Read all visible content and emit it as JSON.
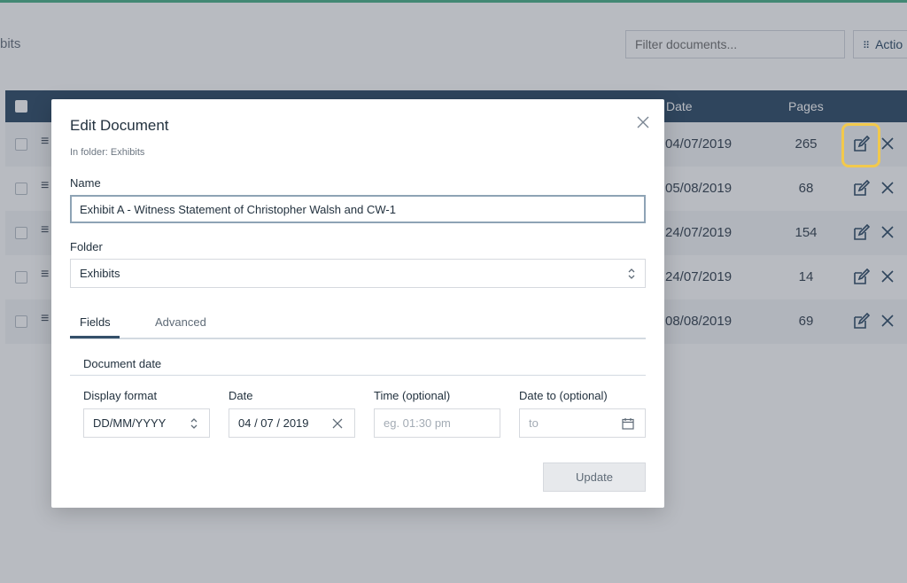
{
  "background": {
    "breadcrumb": "bits",
    "filter_placeholder": "Filter documents...",
    "actions_label": "Actio",
    "table": {
      "headers": {
        "date": "Date",
        "pages": "Pages"
      },
      "rows": [
        {
          "date": "04/07/2019",
          "pages": "265"
        },
        {
          "date": "05/08/2019",
          "pages": "68"
        },
        {
          "date": "24/07/2019",
          "pages": "154"
        },
        {
          "date": "24/07/2019",
          "pages": "14"
        },
        {
          "date": "08/08/2019",
          "pages": "69"
        }
      ]
    }
  },
  "modal": {
    "title": "Edit Document",
    "subtitle": "In folder: Exhibits",
    "name_label": "Name",
    "name_value": "Exhibit A - Witness Statement of Christopher Walsh and CW-1",
    "folder_label": "Folder",
    "folder_value": "Exhibits",
    "tabs": [
      {
        "label": "Fields",
        "active": true
      },
      {
        "label": "Advanced",
        "active": false
      }
    ],
    "section_title": "Document date",
    "fields": {
      "display_format_label": "Display format",
      "display_format_value": "DD/MM/YYYY",
      "date_label": "Date",
      "date_value": "04 / 07 / 2019",
      "time_label": "Time (optional)",
      "time_placeholder": "eg. 01:30 pm",
      "date_to_label": "Date to (optional)",
      "date_to_placeholder": "to"
    },
    "update_label": "Update"
  },
  "colors": {
    "accent": "#4fb38c",
    "table_header": "#34506a",
    "highlight": "#f2c94c"
  },
  "icons": [
    "grid-icon",
    "drag-handle-icon",
    "edit-icon",
    "close-icon",
    "updown-icon",
    "clear-icon",
    "calendar-icon"
  ]
}
